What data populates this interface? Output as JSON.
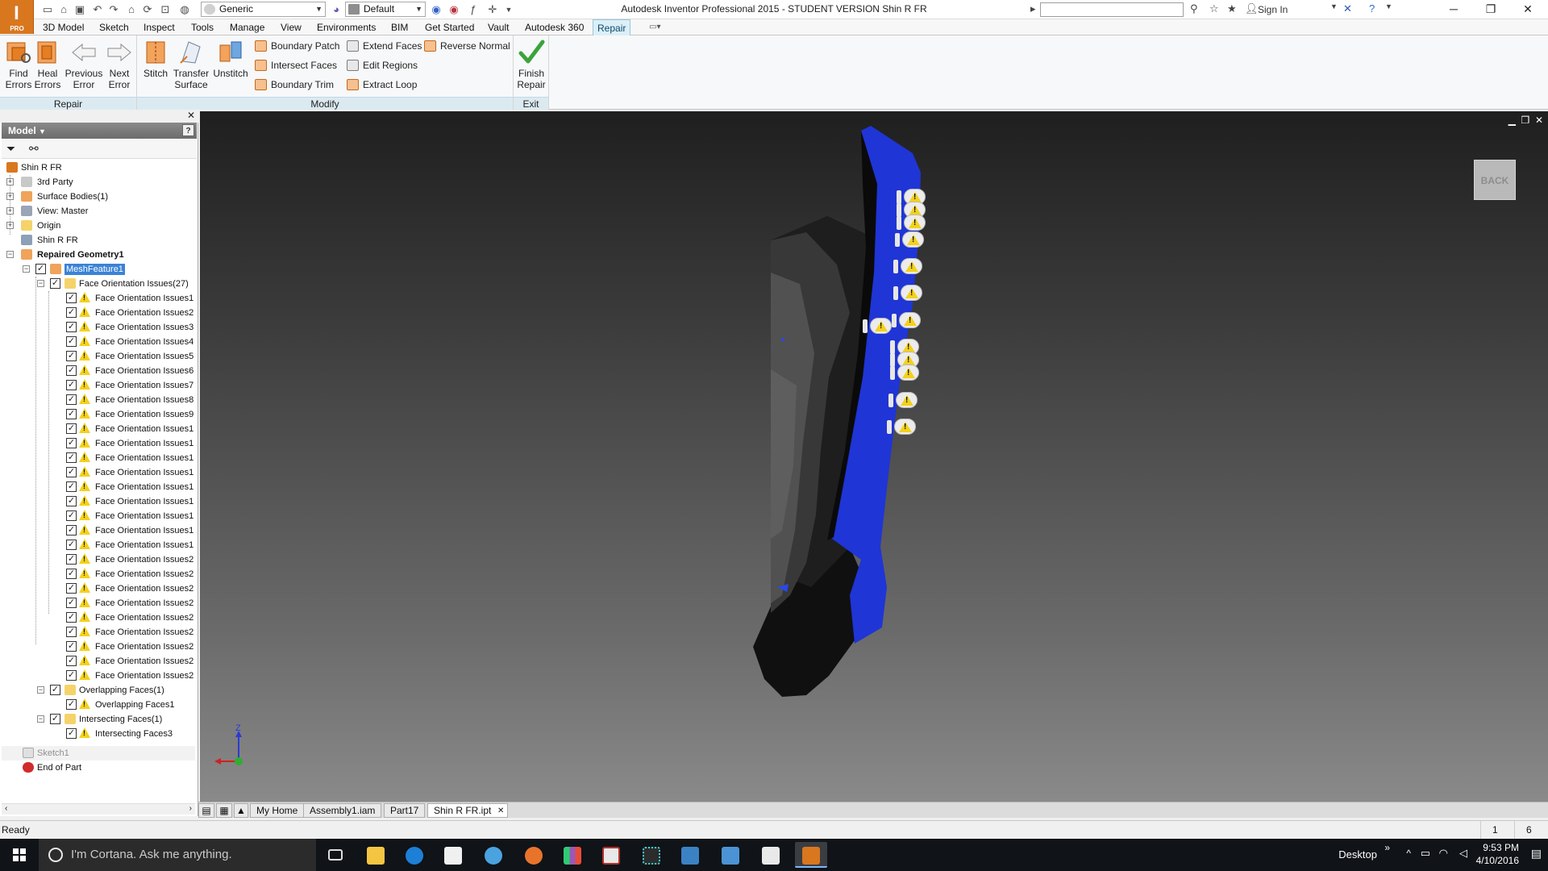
{
  "window": {
    "title": "Autodesk Inventor Professional 2015 - STUDENT VERSION   Shin R FR",
    "app_badge": "PRO",
    "sign_in": "Sign In"
  },
  "qat": {
    "material": "Generic",
    "appearance": "Default"
  },
  "ribbon_tabs": [
    "3D Model",
    "Sketch",
    "Inspect",
    "Tools",
    "Manage",
    "View",
    "Environments",
    "BIM",
    "Get Started",
    "Vault",
    "Autodesk 360",
    "Repair"
  ],
  "active_tab": "Repair",
  "ribbon": {
    "repair_group": {
      "label": "Repair",
      "find_errors": [
        "Find",
        "Errors"
      ],
      "heal_errors": [
        "Heal",
        "Errors"
      ],
      "previous_error": [
        "Previous",
        "Error"
      ],
      "next_error": [
        "Next",
        "Error"
      ]
    },
    "modify_group": {
      "label": "Modify",
      "stitch": "Stitch",
      "transfer_surface": [
        "Transfer",
        "Surface"
      ],
      "unstitch": "Unstitch",
      "boundary_patch": "Boundary Patch",
      "intersect_faces": "Intersect Faces",
      "boundary_trim": "Boundary Trim",
      "extend_faces": "Extend Faces",
      "edit_regions": "Edit Regions",
      "extract_loop": "Extract Loop",
      "reverse_normal": "Reverse Normal"
    },
    "exit_group": {
      "label": "Exit",
      "finish_repair": [
        "Finish",
        "Repair"
      ]
    }
  },
  "browser": {
    "header": "Model",
    "tree": {
      "root": "Shin R FR",
      "third_party": "3rd Party",
      "surface_bodies": "Surface Bodies(1)",
      "view_master": "View: Master",
      "origin": "Origin",
      "shin_part": "Shin R FR",
      "repaired_geometry": "Repaired Geometry1",
      "mesh_feature": "MeshFeature1",
      "face_orientation_group": "Face Orientation Issues(27)",
      "face_orientation_items": [
        "Face Orientation Issues1",
        "Face Orientation Issues2",
        "Face Orientation Issues3",
        "Face Orientation Issues4",
        "Face Orientation Issues5",
        "Face Orientation Issues6",
        "Face Orientation Issues7",
        "Face Orientation Issues8",
        "Face Orientation Issues9",
        "Face Orientation Issues1",
        "Face Orientation Issues1",
        "Face Orientation Issues1",
        "Face Orientation Issues1",
        "Face Orientation Issues1",
        "Face Orientation Issues1",
        "Face Orientation Issues1",
        "Face Orientation Issues1",
        "Face Orientation Issues1",
        "Face Orientation Issues2",
        "Face Orientation Issues2",
        "Face Orientation Issues2",
        "Face Orientation Issues2",
        "Face Orientation Issues2",
        "Face Orientation Issues2",
        "Face Orientation Issues2",
        "Face Orientation Issues2",
        "Face Orientation Issues2"
      ],
      "overlapping_group": "Overlapping Faces(1)",
      "overlapping_item": "Overlapping Faces1",
      "intersecting_group": "Intersecting Faces(1)",
      "intersecting_item": "Intersecting Faces3",
      "sketch": "Sketch1",
      "end_of_part": "End of Part"
    }
  },
  "viewport": {
    "viewcube_face": "BACK",
    "axis_z": "Z",
    "axis_x": "X"
  },
  "doc_tabs": [
    "My Home",
    "Assembly1.iam",
    "Part17",
    "Shin R FR.ipt"
  ],
  "status": {
    "text": "Ready",
    "count_a": "1",
    "count_b": "6"
  },
  "taskbar": {
    "search_placeholder": "I'm Cortana. Ask me anything.",
    "desktop": "Desktop",
    "time": "9:53 PM",
    "date": "4/10/2016"
  },
  "colors": {
    "accent_blue": "#1f35d6",
    "ribbon_active_tab": "#dceff7",
    "selection": "#3b83d6",
    "warning_yellow": "#f3d11b"
  }
}
